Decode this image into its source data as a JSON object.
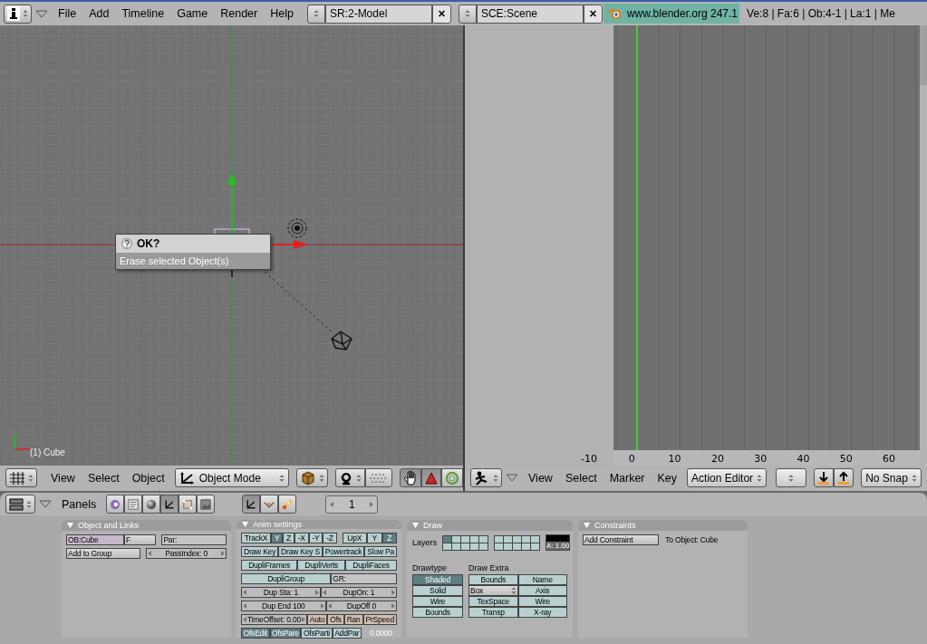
{
  "top_header": {
    "menus": [
      "File",
      "Add",
      "Timeline",
      "Game",
      "Render",
      "Help"
    ],
    "screen": {
      "value": "SR:2-Model"
    },
    "scene": {
      "value": "SCE:Scene"
    },
    "version": "www.blender.org 247.1",
    "stats": "Ve:8 | Fa:6 | Ob:4-1 | La:1  | Me"
  },
  "viewport": {
    "object_label": "(1) Cube",
    "dialog": {
      "title": "OK?",
      "message": "Erase selected Object(s)"
    }
  },
  "viewport_header": {
    "menus": [
      "View",
      "Select",
      "Object"
    ],
    "mode": "Object Mode",
    "tools": [
      {
        "kind": "hand",
        "selected": true
      },
      {
        "kind": "triangle",
        "selected": true
      },
      {
        "kind": "ring",
        "selected": false
      }
    ]
  },
  "timeline": {
    "ruler": [
      "-10",
      "0",
      "10",
      "20",
      "30",
      "40",
      "50",
      "60"
    ]
  },
  "timeline_header": {
    "menus": [
      "View",
      "Select",
      "Marker",
      "Key"
    ],
    "editor": "Action Editor",
    "snap": "No Snap"
  },
  "buttons_header": {
    "label": "Panels",
    "contexts": [
      {
        "kind": "logic",
        "selected": false
      },
      {
        "kind": "script",
        "selected": false
      },
      {
        "kind": "shading",
        "selected": false
      },
      {
        "kind": "object",
        "selected": true
      },
      {
        "kind": "editing",
        "selected": false
      },
      {
        "kind": "scene",
        "selected": false
      }
    ],
    "subcontexts": [
      {
        "kind": "object",
        "selected": true
      },
      {
        "kind": "physics",
        "selected": false
      },
      {
        "kind": "particles",
        "selected": false
      }
    ],
    "frame": "1"
  },
  "panels": [
    {
      "kind": "rows",
      "title": "Object and Links",
      "rows": [
        [
          [
            {
              "kind": "id",
              "text": "OB:Cube"
            },
            {
              "kind": "button",
              "text": "F"
            }
          ],
          [
            {
              "kind": "field",
              "text": "Par:"
            }
          ]
        ],
        [
          [
            {
              "kind": "button",
              "text": "Add to Group"
            }
          ],
          [
            {
              "kind": "number",
              "text": "PassIndex: 0"
            }
          ]
        ]
      ]
    },
    {
      "kind": "rows",
      "title": "Anim settings",
      "rows": [
        [
          [
            {
              "kind": "toggle",
              "text": "TrackX",
              "selected": false
            },
            {
              "kind": "toggle",
              "text": "Y",
              "selected": true
            },
            {
              "kind": "toggle",
              "text": "Z",
              "selected": false
            },
            {
              "kind": "toggle",
              "text": "-X",
              "selected": false
            },
            {
              "kind": "toggle",
              "text": "-Y",
              "selected": false
            },
            {
              "kind": "toggle",
              "text": "-Z",
              "selected": false
            }
          ],
          [
            {
              "kind": "toggle",
              "text": "UpX",
              "selected": false
            },
            {
              "kind": "toggle",
              "text": "Y",
              "selected": false
            },
            {
              "kind": "toggle",
              "text": "Z",
              "selected": true
            }
          ]
        ],
        [
          [
            {
              "kind": "toggle",
              "text": "Draw Key",
              "selected": false
            },
            {
              "kind": "toggle",
              "text": "Draw Key S",
              "selected": false
            },
            {
              "kind": "toggle",
              "text": "Powertrack",
              "selected": false
            },
            {
              "kind": "toggle",
              "text": "Slow Pa",
              "selected": false
            }
          ]
        ],
        [
          [
            {
              "kind": "toggle",
              "text": "DupliFrames",
              "selected": false
            },
            {
              "kind": "toggle",
              "text": "DupliVerts",
              "selected": false
            },
            {
              "kind": "toggle",
              "text": "DupliFaces",
              "selected": false
            }
          ]
        ],
        [
          [
            {
              "kind": "toggle",
              "text": "DupliGroup",
              "selected": false
            },
            {
              "kind": "field",
              "text": "GR:"
            }
          ]
        ],
        [
          [
            {
              "kind": "number",
              "text": "Dup Sta: 1"
            },
            {
              "kind": "number",
              "text": "DupOn: 1"
            }
          ]
        ],
        [
          [
            {
              "kind": "number",
              "text": "Dup End 100"
            },
            {
              "kind": "number",
              "text": "DupOff 0"
            }
          ]
        ],
        [
          [
            {
              "kind": "number",
              "text": "TimeOffset: 0.00"
            },
            {
              "kind": "option",
              "text": "Auto",
              "selected": false
            },
            {
              "kind": "option",
              "text": "Ofs",
              "selected": false
            },
            {
              "kind": "option",
              "text": "Ran",
              "selected": false
            },
            {
              "kind": "option",
              "text": "PrSpeed",
              "selected": false
            }
          ]
        ],
        [
          [
            {
              "kind": "toggle",
              "text": "OfsEdit",
              "selected": true
            },
            {
              "kind": "toggle",
              "text": "OfsPare",
              "selected": true
            },
            {
              "kind": "toggle",
              "text": "OfsParti",
              "selected": false
            },
            {
              "kind": "toggle",
              "text": "AddPar",
              "selected": false
            }
          ],
          [
            {
              "kind": "label",
              "text": "0.0000"
            }
          ]
        ]
      ]
    },
    {
      "kind": "draw",
      "title": "Draw",
      "layers_label": "Layers",
      "layers": [
        [
          {
            "selected": true
          },
          {
            "selected": false
          },
          {
            "selected": false
          },
          {
            "selected": false
          },
          {
            "selected": false
          },
          {
            "selected": false
          },
          {
            "selected": false
          },
          {
            "selected": false
          },
          {
            "selected": false
          },
          {
            "selected": false
          }
        ],
        [
          {
            "selected": false
          },
          {
            "selected": false
          },
          {
            "selected": false
          },
          {
            "selected": false
          },
          {
            "selected": false
          },
          {
            "selected": false
          },
          {
            "selected": false
          },
          {
            "selected": false
          },
          {
            "selected": false
          },
          {
            "selected": false
          }
        ]
      ],
      "alpha": "A: 1.00",
      "drawtype_label": "Drawtype",
      "drawtype": [
        {
          "text": "Shaded",
          "selected": true
        },
        {
          "text": "Solid",
          "selected": false
        },
        {
          "text": "Wire",
          "selected": false
        },
        {
          "text": "Bounds",
          "selected": false
        }
      ],
      "extra_label": "Draw Extra",
      "extra": [
        [
          {
            "kind": "toggle",
            "text": "Bounds",
            "selected": false
          },
          {
            "kind": "toggle",
            "text": "Name",
            "selected": false
          }
        ],
        [
          {
            "kind": "menu",
            "text": "Box"
          },
          {
            "kind": "toggle",
            "text": "Axis",
            "selected": false
          }
        ],
        [
          {
            "kind": "toggle",
            "text": "TexSpace",
            "selected": false
          },
          {
            "kind": "toggle",
            "text": "Wire",
            "selected": false
          }
        ],
        [
          {
            "kind": "toggle",
            "text": "Transp",
            "selected": false
          },
          {
            "kind": "toggle",
            "text": "X-ray",
            "selected": false
          }
        ]
      ]
    },
    {
      "kind": "rows",
      "title": "Constraints",
      "rows": [
        [
          [
            {
              "kind": "button",
              "text": "Add Constraint"
            }
          ],
          [
            {
              "kind": "label",
              "text": "To Object: Cube"
            }
          ]
        ]
      ]
    }
  ]
}
